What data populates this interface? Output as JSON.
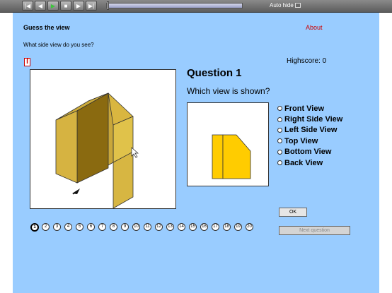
{
  "player": {
    "buttons": [
      {
        "name": "skip-back-icon",
        "glyph": "|◀"
      },
      {
        "name": "rewind-icon",
        "glyph": "◀"
      },
      {
        "name": "play-icon",
        "glyph": "▶"
      },
      {
        "name": "stop-icon",
        "glyph": "■"
      },
      {
        "name": "forward-icon",
        "glyph": "▶"
      },
      {
        "name": "skip-forward-icon",
        "glyph": "▶|"
      }
    ],
    "autohide_label": "Auto hide"
  },
  "app": {
    "title": "Guess the view",
    "about": "About",
    "prompt": "What side view do you see?",
    "highscore": "Highscore: 0",
    "question_title": "Question 1",
    "question_text": "Which view is shown?",
    "options": [
      "Front View",
      "Right Side View",
      "Left Side View",
      "Top View",
      "Bottom View",
      "Back View"
    ],
    "ok_label": "OK",
    "next_label": "Next question",
    "question_numbers": [
      "1",
      "2",
      "3",
      "4",
      "5",
      "6",
      "7",
      "8",
      "9",
      "10",
      "11",
      "12",
      "13",
      "14",
      "15",
      "16",
      "17",
      "18",
      "19",
      "20"
    ],
    "current_question": "1"
  },
  "colors": {
    "background": "#99ccff",
    "part_face": "#ffcc00",
    "part_shade": "#8a6a10",
    "about_link": "#cc0000"
  }
}
